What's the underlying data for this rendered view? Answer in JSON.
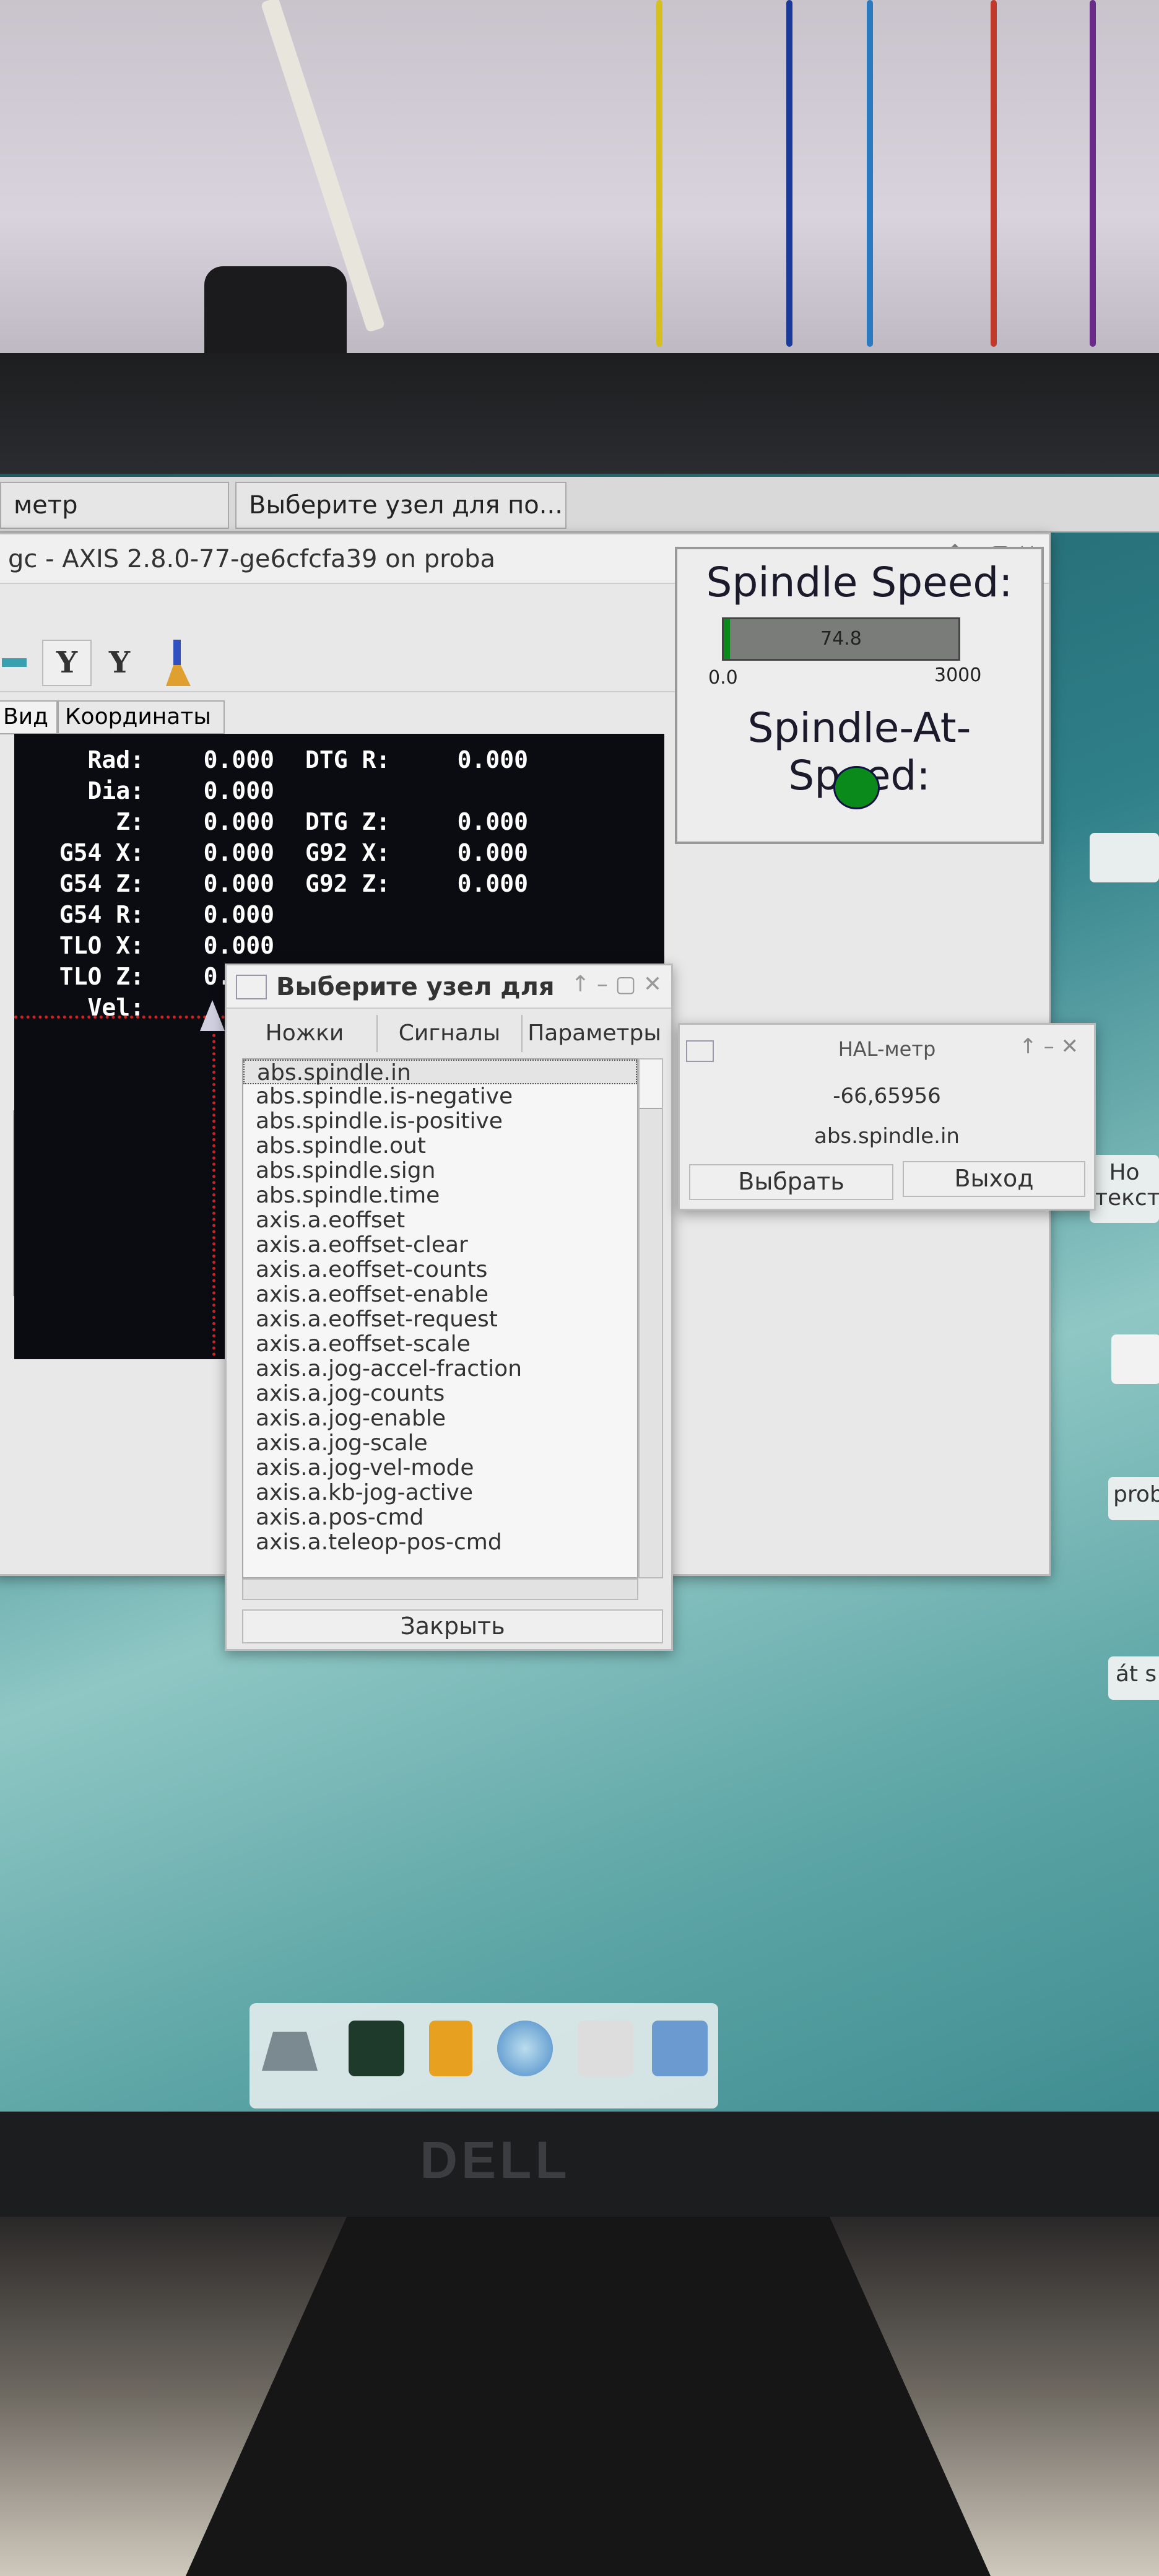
{
  "taskbar": {
    "tabs": [
      {
        "label": "метр"
      },
      {
        "label": "Выберите узел для по..."
      }
    ]
  },
  "axis": {
    "title": "gc - AXIS 2.8.0-77-ge6cfcfa39 on proba",
    "toolbar_icons": [
      "y-view-icon",
      "y-rotated-view-icon",
      "clear-brush-icon"
    ],
    "toolbar_labels": [
      "Y",
      "Y"
    ],
    "tabs": [
      {
        "label": "Вид"
      },
      {
        "label": "Координаты"
      }
    ],
    "dro": [
      {
        "label": "Rad:",
        "value": "0.000",
        "label2": "DTG R:",
        "value2": "0.000"
      },
      {
        "label": "Dia:",
        "value": "0.000"
      },
      {
        "label": "Z:",
        "value": "0.000",
        "label2": "DTG Z:",
        "value2": "0.000"
      },
      {
        "label": "G54 X:",
        "value": "0.000",
        "label2": "G92 X:",
        "value2": "0.000"
      },
      {
        "label": "G54 Z:",
        "value": "0.000",
        "label2": "G92 Z:",
        "value2": "0.000"
      },
      {
        "label": "G54 R:",
        "value": "0.000"
      },
      {
        "label": "TLO X:",
        "value": "0.000"
      },
      {
        "label": "TLO Z:",
        "value": "0.000"
      },
      {
        "label": "Vel:",
        "value": ""
      }
    ]
  },
  "pyvcp": {
    "spindle_speed_label": "Spindle Speed:",
    "bar_value_text": "74.8",
    "bar_value": 74.8,
    "bar_min": "0.0",
    "bar_max": "3000",
    "at_speed_label": "Spindle-At-Speed:",
    "led_color": "#0a8a1a",
    "bar_color": "#0a8a1a"
  },
  "select_dialog": {
    "title": "Выберите узел для",
    "tabs": [
      {
        "label": "Ножки"
      },
      {
        "label": "Сигналы"
      },
      {
        "label": "Параметры"
      }
    ],
    "items": [
      "abs.spindle.in",
      "abs.spindle.is-negative",
      "abs.spindle.is-positive",
      "abs.spindle.out",
      "abs.spindle.sign",
      "abs.spindle.time",
      "axis.a.eoffset",
      "axis.a.eoffset-clear",
      "axis.a.eoffset-counts",
      "axis.a.eoffset-enable",
      "axis.a.eoffset-request",
      "axis.a.eoffset-scale",
      "axis.a.jog-accel-fraction",
      "axis.a.jog-counts",
      "axis.a.jog-enable",
      "axis.a.jog-scale",
      "axis.a.jog-vel-mode",
      "axis.a.kb-jog-active",
      "axis.a.pos-cmd",
      "axis.a.teleop-pos-cmd"
    ],
    "close_label": "Закрыть"
  },
  "halmeter": {
    "title": "HAL-метр",
    "value": "-66,65956",
    "pin": "abs.spindle.in",
    "select_label": "Выбрать",
    "exit_label": "Выход"
  },
  "desktop_icons": [
    {
      "label": "Но текст"
    },
    {
      "label": "prob"
    },
    {
      "label": "át s"
    }
  ],
  "monitor_brand": "DELL"
}
